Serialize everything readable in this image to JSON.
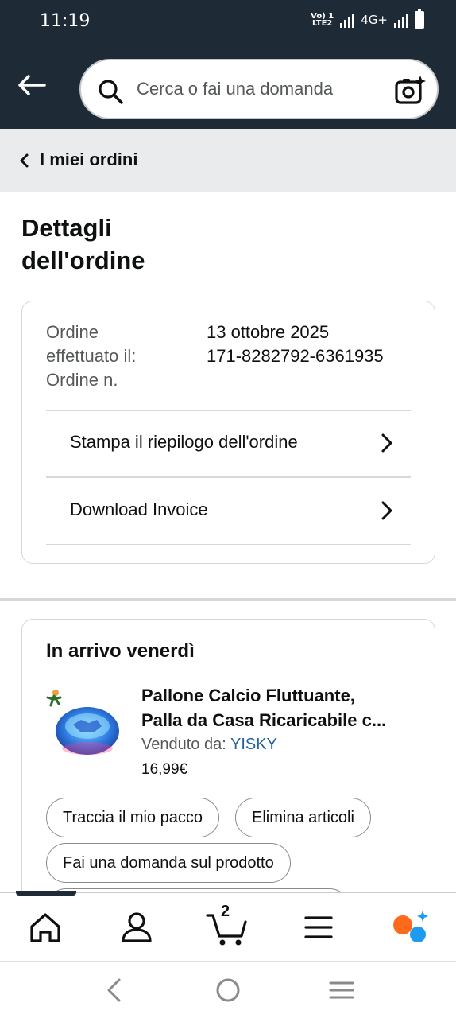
{
  "status_bar": {
    "time": "11:19",
    "network": "4G+",
    "volte": "Vo LTE2"
  },
  "search": {
    "placeholder": "Cerca o fai una domanda"
  },
  "breadcrumb": {
    "label": "I miei ordini"
  },
  "page": {
    "title_line1": "Dettagli",
    "title_line2": "dell'ordine"
  },
  "order_info": {
    "date_label_line1": "Ordine",
    "date_label_line2": "effettuato il:",
    "number_label": "Ordine n.",
    "date_value": "13 ottobre 2025",
    "number_value": "171-8282792-6361935"
  },
  "actions": [
    {
      "label": "Stampa il riepilogo dell'ordine"
    },
    {
      "label": "Download Invoice"
    }
  ],
  "shipment": {
    "heading": "In arrivo venerdì",
    "product_title_line1": "Pallone Calcio Fluttuante,",
    "product_title_line2": "Palla da Casa Ricaricabile c...",
    "sold_by_label": "Venduto da:",
    "seller": "YISKY",
    "price": "16,99€",
    "buttons": [
      "Traccia il mio pacco",
      "Elimina articoli",
      "Fai una domanda sul prodotto"
    ]
  },
  "bottom_nav": {
    "cart_count": "2",
    "items": [
      "home-icon",
      "account-icon",
      "cart-icon",
      "menu-icon",
      "rufus-icon"
    ]
  },
  "colors": {
    "header_bg": "#1f2a37",
    "link_blue": "#2162a1",
    "rufus_orange": "#ff6a1a",
    "rufus_blue": "#1d9bf0"
  }
}
